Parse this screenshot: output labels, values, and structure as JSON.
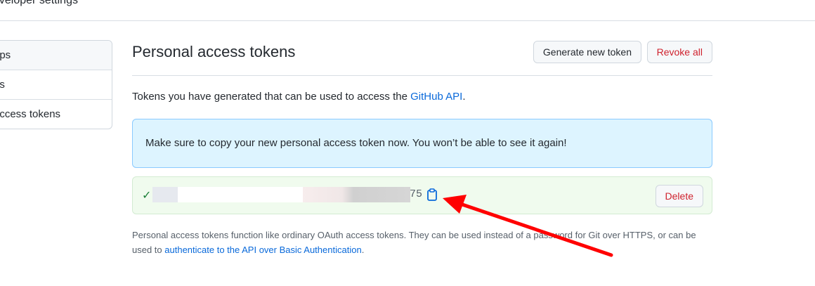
{
  "header": {
    "title": "eveloper settings"
  },
  "sidebar": {
    "items": [
      {
        "label": "ops",
        "selected": true
      },
      {
        "label": "ps",
        "selected": false
      },
      {
        "label": "access tokens",
        "selected": false
      }
    ]
  },
  "main": {
    "title": "Personal access tokens",
    "generate_label": "Generate new token",
    "revoke_label": "Revoke all",
    "intro_text": "Tokens you have generated that can be used to access the ",
    "intro_link": "GitHub API",
    "intro_end": ".",
    "flash_text": "Make sure to copy your new personal access token now. You won’t be able to see it again!",
    "token": {
      "visible_suffix": "75",
      "delete_label": "Delete"
    },
    "footer_text": "Personal access tokens function like ordinary OAuth access tokens. They can be used instead of a password for Git over HTTPS, or can be used to ",
    "footer_link": "authenticate to the API over Basic Authentication",
    "footer_end": "."
  },
  "icons": {
    "check": "check-icon",
    "copy": "clipboard-icon",
    "annotation": "red-arrow"
  },
  "colors": {
    "link": "#0969da",
    "danger": "#cf222e",
    "success": "#1a7f37",
    "flash_bg": "#ddf4ff",
    "token_bg": "#f0fbee",
    "arrow": "#ff0000"
  }
}
